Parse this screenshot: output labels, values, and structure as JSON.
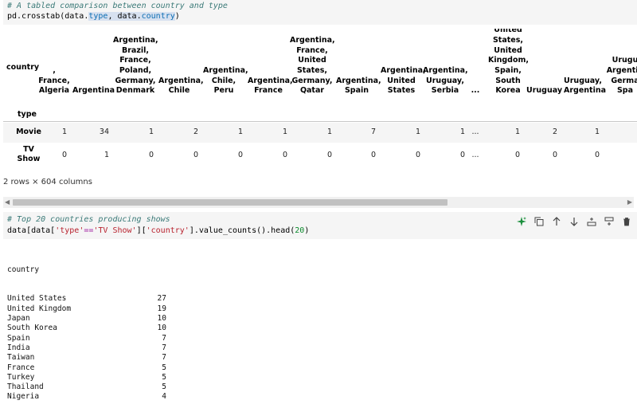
{
  "cell1": {
    "comment": "# A tabled comparison between country and type",
    "code_prefix": "pd.crosstab(data.",
    "code_attr1": "type",
    "code_mid": ", data.",
    "code_attr2": "country",
    "code_suffix": ")"
  },
  "crosstab": {
    "columns_name": "country",
    "index_name": "type",
    "headers": [
      ", France, Algeria",
      "Argentina",
      "Argentina, Brazil, France, Poland, Germany, Denmark",
      "Argentina, Chile",
      "Argentina, Chile, Peru",
      "Argentina, France",
      "Argentina, France, United States, Germany, Qatar",
      "Argentina, Spain",
      "Argentina, United States",
      "Argentina, Uruguay, Serbia",
      "...",
      "United States, United Kingdom, Spain, South Korea",
      "Uruguay",
      "Uruguay, Argentina",
      "Uruguay, Argentina, Germany, Spain"
    ],
    "header_lines": [
      [
        "",
        ",",
        "France,",
        "Algeria"
      ],
      [
        "Argentina"
      ],
      [
        "Argentina,",
        "Brazil,",
        "France,",
        "Poland,",
        "Germany,",
        "Denmark"
      ],
      [
        "Argentina,",
        "Chile"
      ],
      [
        "Argentina,",
        "Chile,",
        "Peru"
      ],
      [
        "Argentina,",
        "France"
      ],
      [
        "Argentina,",
        "France,",
        "United",
        "States,",
        "Germany,",
        "Qatar"
      ],
      [
        "Argentina,",
        "Spain"
      ],
      [
        "Argentina,",
        "United",
        "States"
      ],
      [
        "Argentina,",
        "Uruguay,",
        "Serbia"
      ],
      [
        "..."
      ],
      [
        "United",
        "States,",
        "United",
        "Kingdom,",
        "Spain,",
        "South",
        "Korea"
      ],
      [
        "Uruguay"
      ],
      [
        "Uruguay,",
        "Argentina"
      ],
      [
        "Urugu",
        "Argentin",
        "Germa",
        "Spa"
      ]
    ],
    "rows": [
      {
        "label": "Movie",
        "values": [
          "1",
          "34",
          "1",
          "2",
          "1",
          "1",
          "1",
          "7",
          "1",
          "1",
          "...",
          "1",
          "2",
          "1",
          ""
        ]
      },
      {
        "label": "TV\nShow",
        "values": [
          "0",
          "1",
          "0",
          "0",
          "0",
          "0",
          "0",
          "0",
          "0",
          "0",
          "...",
          "0",
          "0",
          "0",
          ""
        ]
      }
    ],
    "shape": "2 rows × 604 columns"
  },
  "cell2": {
    "comment": "# Top 20 countries producing shows",
    "code_a": "data[data[",
    "code_str1": "'type'",
    "code_op": "==",
    "code_str2": "'TV Show'",
    "code_b": "][",
    "code_str3": "'country'",
    "code_c": "].value_counts().head(",
    "code_num": "20",
    "code_d": ")",
    "toolbar": [
      "sparkle-icon",
      "copy-icon",
      "arrow-up-icon",
      "arrow-down-icon",
      "insert-below-icon",
      "insert-above-icon",
      "trash-icon"
    ]
  },
  "output2": {
    "header": "country",
    "rows": [
      {
        "k": "United States",
        "v": "27"
      },
      {
        "k": "United Kingdom",
        "v": "19"
      },
      {
        "k": "Japan",
        "v": "10"
      },
      {
        "k": "South Korea",
        "v": "10"
      },
      {
        "k": "Spain",
        "v": "7"
      },
      {
        "k": "India",
        "v": "7"
      },
      {
        "k": "Taiwan",
        "v": "7"
      },
      {
        "k": "France",
        "v": "5"
      },
      {
        "k": "Turkey",
        "v": "5"
      },
      {
        "k": "Thailand",
        "v": "5"
      },
      {
        "k": "Nigeria",
        "v": "4"
      }
    ]
  },
  "colors": {
    "accent_green": "#1a8f3c",
    "comment": "#3b7a78",
    "string": "#b8222e"
  }
}
